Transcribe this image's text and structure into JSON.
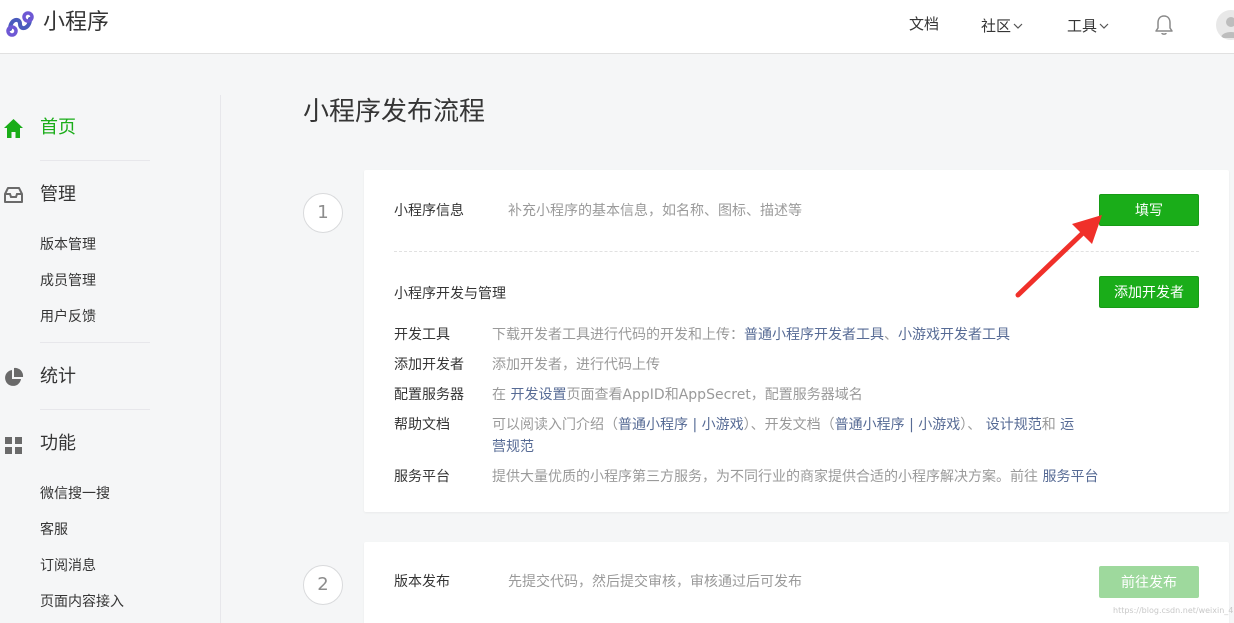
{
  "header": {
    "logo_text": "小程序",
    "nav": {
      "docs": "文档",
      "community": "社区",
      "tools": "工具"
    }
  },
  "sidebar": {
    "home": "首页",
    "manage": "管理",
    "manage_items": [
      "版本管理",
      "成员管理",
      "用户反馈"
    ],
    "stats": "统计",
    "features": "功能",
    "feature_items": [
      "微信搜一搜",
      "客服",
      "订阅消息",
      "页面内容接入"
    ]
  },
  "main": {
    "title": "小程序发布流程",
    "step1": {
      "number": "1",
      "info_title": "小程序信息",
      "info_desc": "补充小程序的基本信息，如名称、图标、描述等",
      "fill_button": "填写",
      "dev_title": "小程序开发与管理",
      "add_dev_button": "添加开发者",
      "details": {
        "tools_label": "开发工具",
        "tools_text": "下载开发者工具进行代码的开发和上传：",
        "tools_link1": "普通小程序开发者工具",
        "tools_sep": "、",
        "tools_link2": "小游戏开发者工具",
        "adddev_label": "添加开发者",
        "adddev_text": "添加开发者，进行代码上传",
        "server_label": "配置服务器",
        "server_pre": "在",
        "server_link": "开发设置",
        "server_post": "页面查看AppID和AppSecret，配置服务器域名",
        "help_label": "帮助文档",
        "help_t1": "可以阅读入门介绍（",
        "help_l1": "普通小程序",
        "help_bar1": "|",
        "help_l2": "小游戏",
        "help_t2": "）、开发文档（",
        "help_l3": "普通小程序",
        "help_bar2": "|",
        "help_l4": "小游戏",
        "help_t3": "）、",
        "help_l5": "设计规范",
        "help_t4": "和",
        "help_l6a": "运",
        "help_l6b": "营规范",
        "service_label": "服务平台",
        "service_text": "提供大量优质的小程序第三方服务，为不同行业的商家提供合适的小程序解决方案。前往",
        "service_link": "服务平台"
      }
    },
    "step2": {
      "number": "2",
      "title": "版本发布",
      "desc": "先提交代码，然后提交审核，审核通过后可发布",
      "button": "前往发布"
    }
  },
  "watermark": "https://blog.csdn.net/weixin_4393",
  "colors": {
    "accent_green": "#1aad19",
    "link_blue": "#576b95",
    "arrow_red": "#f0302a"
  }
}
